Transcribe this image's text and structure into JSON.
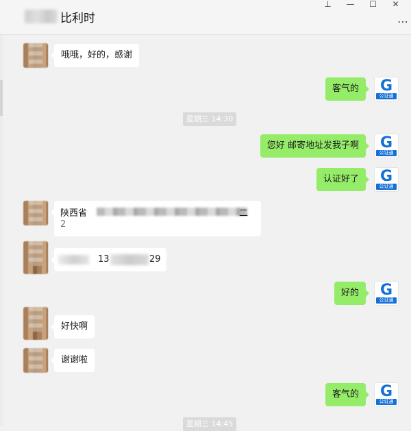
{
  "window": {
    "title": "比利时",
    "pin_icon": "pin-icon",
    "minimize_icon": "minimize-icon",
    "maximize_icon": "maximize-icon",
    "close_icon": "close-icon",
    "more_icon": "more-icon"
  },
  "messages": [
    {
      "side": "left",
      "text": "哦哦，好的，感谢"
    },
    {
      "side": "right",
      "text": "客气的"
    },
    {
      "side": "time",
      "text": "星期三 14:30"
    },
    {
      "side": "right",
      "text": "您好  邮寄地址发我子啊"
    },
    {
      "side": "right",
      "text": "认证好了"
    },
    {
      "side": "left",
      "text_start": "陕西省",
      "text_end": "二",
      "line2": "2"
    },
    {
      "side": "left",
      "phone_visible_start": "13",
      "phone_visible_end": "29"
    },
    {
      "side": "right",
      "text": "好的"
    },
    {
      "side": "left",
      "text": "好快啊"
    },
    {
      "side": "left",
      "text": "谢谢啦"
    },
    {
      "side": "right",
      "text": "客气的"
    },
    {
      "side": "time",
      "text": "星期三 14:45"
    }
  ],
  "logo": {
    "letter": "G",
    "caption": "公证通",
    "color": "#1570d6"
  },
  "colors": {
    "right_bubble": "#95ec69",
    "left_bubble": "#ffffff",
    "background": "#f1f1f1"
  }
}
